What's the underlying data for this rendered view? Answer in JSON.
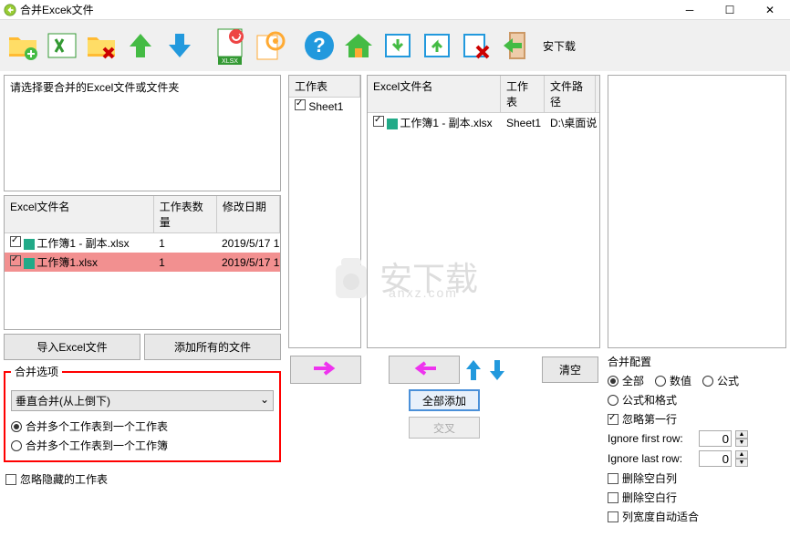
{
  "title": "合并Excek文件",
  "sidebar_brand": "安下载",
  "left": {
    "prompt": "请选择要合并的Excel文件或文件夹",
    "fileTable": {
      "headers": [
        "Excel文件名",
        "工作表数量",
        "修改日期"
      ],
      "rows": [
        {
          "name": "工作簿1 - 副本.xlsx",
          "count": "1",
          "date": "2019/5/17 1",
          "selected": false,
          "checked": true
        },
        {
          "name": "工作簿1.xlsx",
          "count": "1",
          "date": "2019/5/17 1",
          "selected": true,
          "checked": true
        }
      ]
    },
    "btn_import": "导入Excel文件",
    "btn_add_all": "添加所有的文件",
    "merge_legend": "合并选项",
    "merge_select": "垂直合并(从上倒下)",
    "merge_opt1": "合并多个工作表到一个工作表",
    "merge_opt2": "合并多个工作表到一个工作簿",
    "ignore_hidden": "忽略隐藏的工作表"
  },
  "mid": {
    "sheets_header": "工作表",
    "sheets": [
      {
        "name": "Sheet1",
        "checked": true
      }
    ],
    "excel_headers": [
      "Excel文件名",
      "工作表",
      "文件路径"
    ],
    "excel_rows": [
      {
        "name": "工作簿1 - 副本.xlsx",
        "sheet": "Sheet1",
        "path": "D:\\桌面说",
        "checked": true
      }
    ],
    "btn_right": "→",
    "btn_left": "←",
    "btn_add_all": "全部添加",
    "btn_cross": "交叉",
    "btn_clear": "清空"
  },
  "right": {
    "config_title": "合并配置",
    "opt_all": "全部",
    "opt_num": "数值",
    "opt_formula": "公式",
    "opt_formula_fmt": "公式和格式",
    "ignore_first": "忽略第一行",
    "ignore_first_row_label": "Ignore first row:",
    "ignore_first_row_val": "0",
    "ignore_last_row_label": "Ignore last row:",
    "ignore_last_row_val": "0",
    "del_blank_col": "删除空白列",
    "del_blank_row": "删除空白行",
    "auto_width": "列宽度自动适合"
  }
}
